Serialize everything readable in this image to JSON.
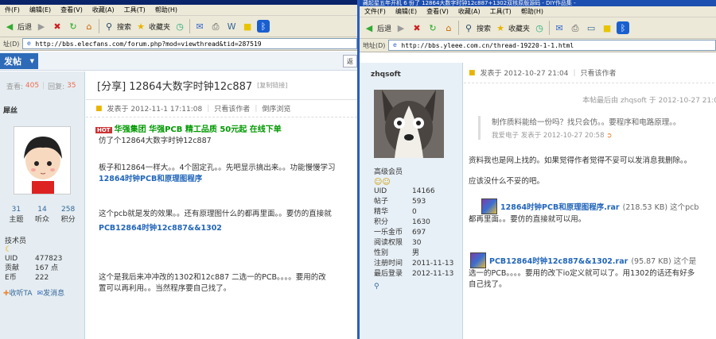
{
  "left": {
    "menu": [
      "件(F)",
      "编辑(E)",
      "查看(V)",
      "收藏(A)",
      "工具(T)",
      "帮助(H)"
    ],
    "toolbar": {
      "back": "后退",
      "search": "搜索",
      "favorites": "收藏夹"
    },
    "address": {
      "label": "址(D)",
      "url": "http://bbs.elecfans.com/forum.php?mod=viewthread&tid=287519"
    },
    "post_button": "发帖",
    "back_button": "返",
    "stats": {
      "views_label": "查看:",
      "views": "405",
      "replies_label": "回复:",
      "replies": "35"
    },
    "thread_title": "[分享] 12864大数字时钟12c887",
    "copy_link": "[复制链接]",
    "username": "犀丝",
    "counts": [
      {
        "value": "31",
        "label": "主题"
      },
      {
        "value": "14",
        "label": "听众"
      },
      {
        "value": "258",
        "label": "积分"
      }
    ],
    "role": "技术员",
    "profile": [
      {
        "k": "UID",
        "v": "477823"
      },
      {
        "k": "贡献",
        "v": "167 点"
      },
      {
        "k": "E币",
        "v": "222"
      }
    ],
    "links": [
      "收听TA",
      "发消息"
    ],
    "meta": {
      "posted": "发表于 2012-11-1 17:11:08",
      "author_only": "只看该作者",
      "reverse": "倒序浏览"
    },
    "ad": {
      "badge": "HOT",
      "text": "华强集团 华强PCB 精工品质 50元起 在线下单"
    },
    "body": {
      "l1": "仿了个12864大数字时钟12c887",
      "l2": "板子和12864一样大。。4个固定孔。。先吧显示搞出来。。功能慢慢学习",
      "l3": "12864时钟PCB和原理图程序",
      "l4": "这个pcb就是发的效果。。还有原理图什么的都再里面。。要仿的直接就",
      "l5": "PCB12864时钟12c887&&1302",
      "l6": "这个是我后来冲冲改的1302和12c887   二选一的PCB。。。。要用的改",
      "l7": "置可以再利用。。当然程序要自己找了。"
    }
  },
  "right": {
    "title": "藏起星五年开机 6 份了 12864大数字时钟12c887+1302双核原版源码 - DIY作品集 -",
    "menu": [
      "文件(F)",
      "编辑(E)",
      "查看(V)",
      "收藏(A)",
      "工具(T)",
      "帮助(H)"
    ],
    "toolbar": {
      "back": "后退",
      "search": "搜索",
      "favorites": "收藏夹"
    },
    "address": {
      "label": "地址(D)",
      "url": "http://bbs.yleee.com.cn/thread-19220-1-1.html"
    },
    "username": "zhqsoft",
    "level": "高级会员",
    "profile": [
      {
        "k": "UID",
        "v": "14166"
      },
      {
        "k": "帖子",
        "v": "593"
      },
      {
        "k": "精华",
        "v": "0"
      },
      {
        "k": "积分",
        "v": "1630"
      },
      {
        "k": "一乐金币",
        "v": "697"
      },
      {
        "k": "阅读权限",
        "v": "30"
      },
      {
        "k": "性别",
        "v": "男"
      },
      {
        "k": "注册时间",
        "v": "2011-11-13"
      },
      {
        "k": "最后登录",
        "v": "2012-11-13"
      }
    ],
    "meta": {
      "posted": "发表于  2012-10-27 21:04",
      "author_only": "只看该作者"
    },
    "edited": "本帖最后由  zhqsoft 于  2012-10-27 21:0",
    "quote": {
      "text": "制作质料能给一份吗？找只会仿。。要程序和电路原理。。",
      "by": "我爱电子  发表于  2012-10-27 20:58"
    },
    "body": {
      "l1": "资料我也是网上找的。如果觉得作者觉得不妥可以发消息我删除。。",
      "l2": "应该没什么不妥的吧。",
      "att1_name": "12864时钟PCB和原理图程序.rar",
      "att1_size": "(218.53 KB) 这个pcb",
      "l3": "都再里面。。要仿的直接就可以用。",
      "att2_name": "PCB12864时钟12c887&&1302.rar",
      "att2_size": "(95.87 KB) 这个是",
      "l4": "选一的PCB。。。。要用的改下io定义就可以了。用1302的话还有好多",
      "l5": "自己找了。"
    }
  }
}
